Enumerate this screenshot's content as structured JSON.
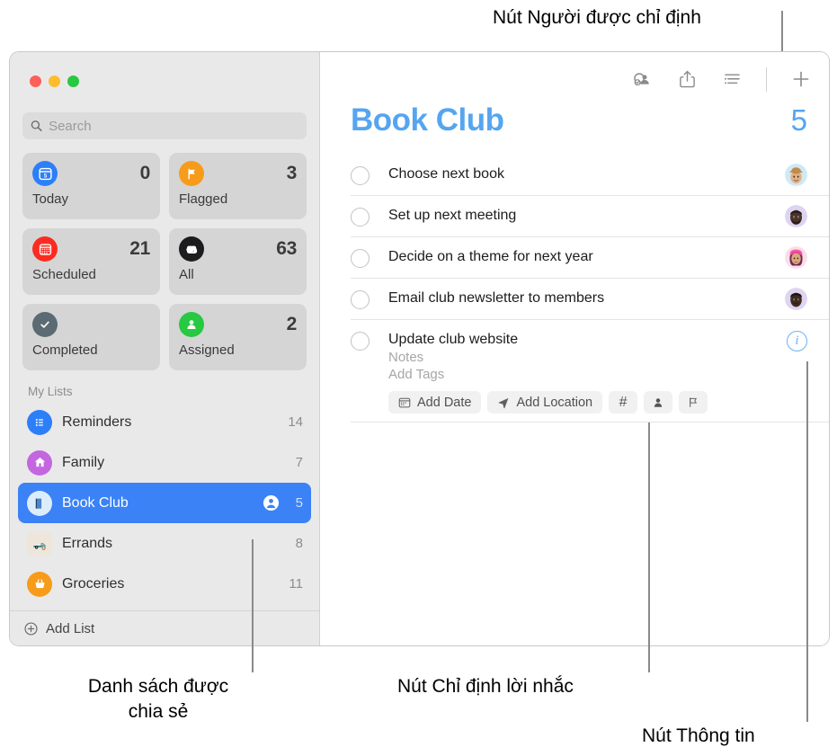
{
  "callouts": {
    "assignee_button": "Nút Người được chỉ định",
    "shared_list": "Danh sách được\nchia sẻ",
    "assign_reminder_button": "Nút Chỉ định lời nhắc",
    "info_button": "Nút Thông tin"
  },
  "window": {
    "traffic_lights": [
      "close",
      "minimize",
      "zoom"
    ]
  },
  "sidebar": {
    "search": {
      "value": "",
      "placeholder": "Search",
      "icon": "search-icon"
    },
    "smart_lists": [
      {
        "label": "Today",
        "count": "0",
        "icon": "today-calendar-icon",
        "color": "#2d7ff9",
        "glyph": "5"
      },
      {
        "label": "Flagged",
        "count": "3",
        "icon": "flag-icon",
        "color": "#f79b1b",
        "glyph": "⚑"
      },
      {
        "label": "Scheduled",
        "count": "21",
        "icon": "scheduled-calendar-icon",
        "color": "#fa2c21",
        "glyph": "▦"
      },
      {
        "label": "All",
        "count": "63",
        "icon": "inbox-tray-icon",
        "color": "#1c1c1e",
        "glyph": "▱"
      },
      {
        "label": "Completed",
        "count": "",
        "icon": "checkmark-icon",
        "color": "#5c6b73",
        "glyph": "✓"
      },
      {
        "label": "Assigned",
        "count": "2",
        "icon": "person-icon",
        "color": "#26c940",
        "glyph": "person"
      }
    ],
    "my_lists_header": "My Lists",
    "lists": [
      {
        "label": "Reminders",
        "count": "14",
        "icon": "list-bullet-icon",
        "color": "#2d7ff9",
        "glyph": "☰",
        "selected": false,
        "shared": false
      },
      {
        "label": "Family",
        "count": "7",
        "icon": "house-icon",
        "color": "#c466e0",
        "glyph": "⌂",
        "selected": false,
        "shared": false
      },
      {
        "label": "Book Club",
        "count": "5",
        "icon": "book-icon",
        "color": "#dcecfb",
        "glyph": "📘",
        "selected": true,
        "shared": true
      },
      {
        "label": "Errands",
        "count": "8",
        "icon": "truck-icon",
        "color": "#eee6da",
        "glyph": "🛻",
        "selected": false,
        "shared": false
      },
      {
        "label": "Groceries",
        "count": "11",
        "icon": "basket-icon",
        "color": "#f79b1b",
        "glyph": "🧺",
        "selected": false,
        "shared": false
      }
    ],
    "add_list_label": "Add List",
    "add_list_icon": "plus-circle-icon"
  },
  "main": {
    "toolbar_buttons": [
      {
        "name": "assignee-button",
        "icon": "person-badge-checkmark-icon"
      },
      {
        "name": "share-button",
        "icon": "share-square-arrow-up-icon"
      },
      {
        "name": "list-options-button",
        "icon": "list-lines-icon"
      },
      {
        "name": "add-reminder-button",
        "icon": "plus-icon"
      }
    ],
    "title": "Book Club",
    "title_count": "5",
    "accent_color": "#55a5f0",
    "reminders": [
      {
        "title": "Choose next book",
        "avatar": "avatar-hat-person",
        "avatar_bg": "#cfe9f5",
        "avatar_face": "#d8a878",
        "expanded": false
      },
      {
        "title": "Set up next meeting",
        "avatar": "avatar-beard-person",
        "avatar_bg": "#ddd3f2",
        "avatar_face": "#3b2a22",
        "expanded": false
      },
      {
        "title": "Decide on a theme for next year",
        "avatar": "avatar-pink-hair-person",
        "avatar_bg": "#fbdde8",
        "avatar_face": "#d4409a",
        "expanded": false
      },
      {
        "title": "Email club newsletter to members",
        "avatar": "avatar-dark-person",
        "avatar_bg": "#ded5f2",
        "avatar_face": "#2e211c",
        "expanded": false
      },
      {
        "title": "Update club website",
        "expanded": true,
        "notes_placeholder": "Notes",
        "tags_placeholder": "Add Tags",
        "actions": [
          {
            "label": "Add Date",
            "icon": "calendar-icon",
            "name": "add-date-button"
          },
          {
            "label": "Add Location",
            "icon": "location-arrow-icon",
            "name": "add-location-button"
          },
          {
            "label": "#",
            "icon": "hash-tag-icon",
            "name": "add-tag-button"
          },
          {
            "label": "",
            "icon": "person-fill-icon",
            "name": "assign-reminder-button"
          },
          {
            "label": "",
            "icon": "flag-outline-icon",
            "name": "flag-button"
          }
        ],
        "info_label": "i"
      }
    ]
  }
}
